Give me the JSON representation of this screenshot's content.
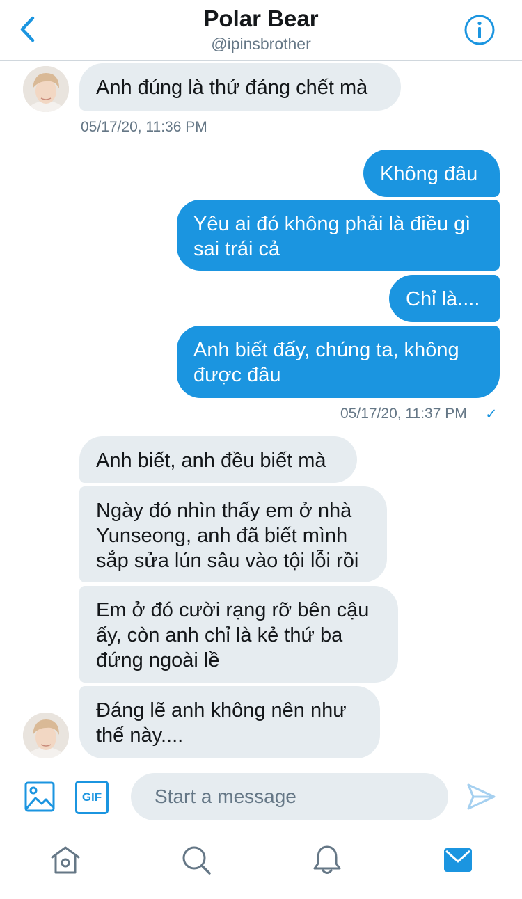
{
  "header": {
    "title": "Polar Bear",
    "handle": "@ipinsbrother",
    "back_icon": "chevron-left-icon",
    "info_icon": "info-icon"
  },
  "colors": {
    "accent": "#1b95e0",
    "incoming_bubble": "#e6ecf0",
    "outgoing_bubble": "#1b95e0",
    "muted_text": "#657786"
  },
  "conversation": {
    "group1": {
      "messages": [
        "Anh đúng là thứ đáng chết mà"
      ],
      "timestamp": "05/17/20, 11:36 PM"
    },
    "group2": {
      "messages": [
        "Không đâu",
        [
          "Yêu ai đó không phải là điều gì",
          "sai trái cả"
        ],
        "Chỉ là....",
        [
          "Anh biết đấy, chúng ta, không",
          "được đâu"
        ]
      ],
      "timestamp": "05/17/20, 11:37 PM",
      "read_mark": "✓"
    },
    "group3": {
      "messages": [
        "Anh biết, anh đều biết mà",
        [
          "Ngày đó nhìn thấy em ở nhà",
          "Yunseong, anh đã biết mình",
          "sắp sửa lún sâu vào tội lỗi rồi"
        ],
        [
          "Em ở đó cười rạng rỡ bên cậu",
          "ấy, còn anh chỉ là kẻ thứ ba",
          "đứng ngoài lề"
        ],
        [
          "Đáng lẽ anh không nên như",
          "thế này...."
        ]
      ]
    }
  },
  "composer": {
    "placeholder": "Start a message",
    "image_icon": "image-icon",
    "gif_label": "GIF",
    "send_icon": "send-icon"
  },
  "tabbar": {
    "items": [
      "home-icon",
      "search-icon",
      "notifications-icon",
      "messages-icon"
    ]
  }
}
